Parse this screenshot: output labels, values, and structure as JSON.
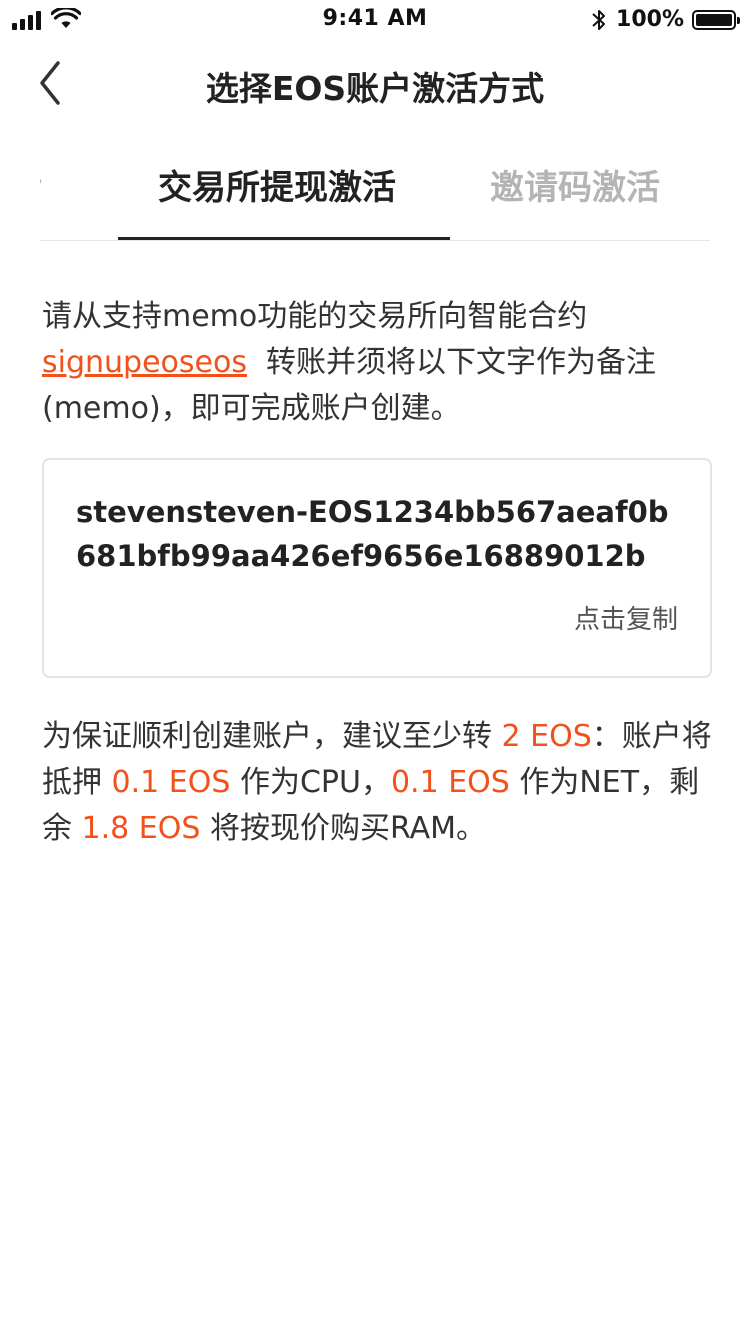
{
  "status_bar": {
    "time": "9:41 AM",
    "battery_percent": "100%",
    "icons": [
      "signal-icon",
      "wifi-icon",
      "bluetooth-icon",
      "battery-icon"
    ]
  },
  "nav": {
    "title": "选择EOS账户激活方式",
    "back_icon": "chevron-left-icon"
  },
  "tabs": [
    {
      "label": "活",
      "active": false
    },
    {
      "label": "交易所提现激活",
      "active": true
    },
    {
      "label": "邀请码激活",
      "active": false
    }
  ],
  "intro": {
    "before_link": "请从支持memo功能的交易所向智能合约",
    "link_text": "signupeoseos",
    "after_link": "转账并须将以下文字作为备注(memo)，即可完成账户创建。"
  },
  "memo": {
    "value": "stevensteven-EOS1234bb567aeaf0b681bfb99aa426ef9656e16889012b",
    "copy_label": "点击复制"
  },
  "suggestion": {
    "part1": "为保证顺利创建账户，建议至少转 ",
    "amount_total": "2 EOS",
    "part2": "：账户将抵押 ",
    "amount_cpu": "0.1 EOS",
    "part3": " 作为CPU，",
    "amount_net": "0.1 EOS",
    "part4": " 作为NET，剩余 ",
    "amount_ram": "1.8 EOS",
    "part5": " 将按现价购买RAM。"
  },
  "colors": {
    "accent": "#f2511b",
    "text_primary": "#222222",
    "text_inactive": "#b4b4b4",
    "border": "#e3e3e3"
  }
}
